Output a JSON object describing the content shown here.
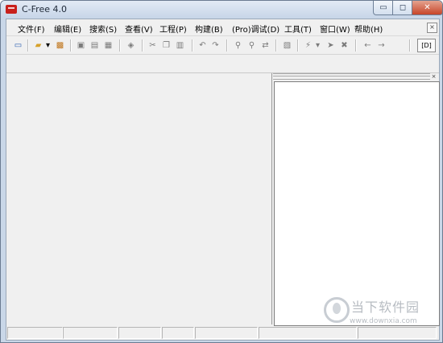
{
  "window": {
    "title": "C-Free 4.0",
    "min_glyph": "▭",
    "max_glyph": "◻",
    "close_glyph": "✕"
  },
  "menubar": {
    "items": [
      "文件(F)",
      "编辑(E)",
      "搜索(S)",
      "查看(V)",
      "工程(P)",
      "构建(B)",
      "(Pro)调试(D)",
      "工具(T)",
      "窗口(W)",
      "帮助(H)"
    ],
    "close_glyph": "×"
  },
  "toolbar": {
    "icons": [
      "new-file-icon",
      "open-folder-icon",
      "dropdown-arrow-icon",
      "open-project-icon",
      "save-icon",
      "save-as-icon",
      "save-all-icon",
      "print-icon",
      "cut-icon",
      "copy-icon",
      "paste-icon",
      "undo-icon",
      "redo-icon",
      "find-icon",
      "find-next-icon",
      "replace-icon",
      "bookmark-icon",
      "compile-icon",
      "compile-dropdown-icon",
      "run-icon",
      "stop-icon",
      "nav-back-icon",
      "nav-forward-icon"
    ],
    "glyphs": [
      "▭",
      "▰",
      "▾",
      "▩",
      "▣",
      "▤",
      "▦",
      "◈",
      "✂",
      "❐",
      "▥",
      "↶",
      "↷",
      "⚲",
      "⚲",
      "⇄",
      "▧",
      "⚡",
      "▾",
      "➤",
      "✖",
      "←",
      "→"
    ],
    "debug_label": "[D]"
  },
  "watermark": {
    "brand_cn": "当下软件园",
    "url": "www.downxia.com"
  },
  "colors": {
    "accent": "#2c5fb0",
    "title_bg": "#c7d6e8",
    "close_red": "#c74529"
  }
}
